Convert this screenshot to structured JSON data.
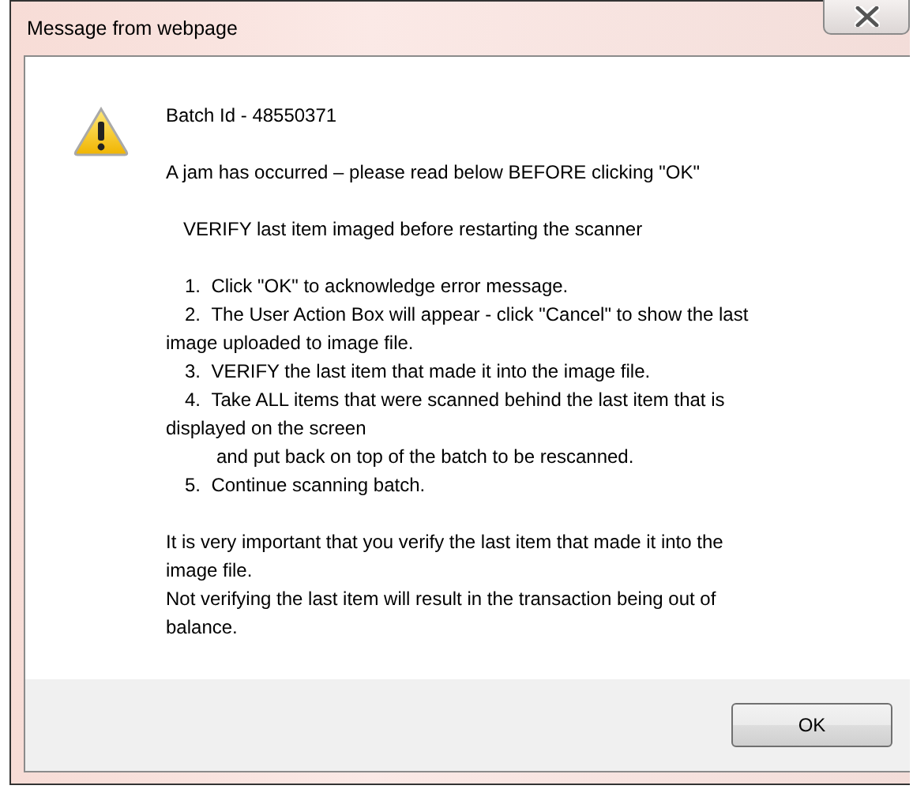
{
  "window": {
    "title": "Message from webpage"
  },
  "message": {
    "heading": "Batch Id - 48550371",
    "warning": "A jam has occurred – please read below BEFORE clicking \"OK\"",
    "instruction": "VERIFY last item imaged before restarting the scanner",
    "steps": [
      {
        "number": "1.",
        "text": "Click \"OK\" to acknowledge error message."
      },
      {
        "number": "2.",
        "text": "The User Action Box will appear - click \"Cancel\" to show the last\nimage uploaded to image file."
      },
      {
        "number": "3.",
        "text": "VERIFY the last item that made it into the image file."
      },
      {
        "number": "4.",
        "text": "Take ALL items that were scanned behind the last item that is\ndisplayed on the screen",
        "continuation": "and put back on top of the batch to be rescanned."
      },
      {
        "number": "5.",
        "text": "Continue scanning batch."
      }
    ],
    "notes": [
      "It is very important that you verify the last item that made it into the\nimage file.",
      "Not verifying the last item will result in the transaction being out of\nbalance."
    ]
  },
  "buttons": [
    "OK"
  ]
}
